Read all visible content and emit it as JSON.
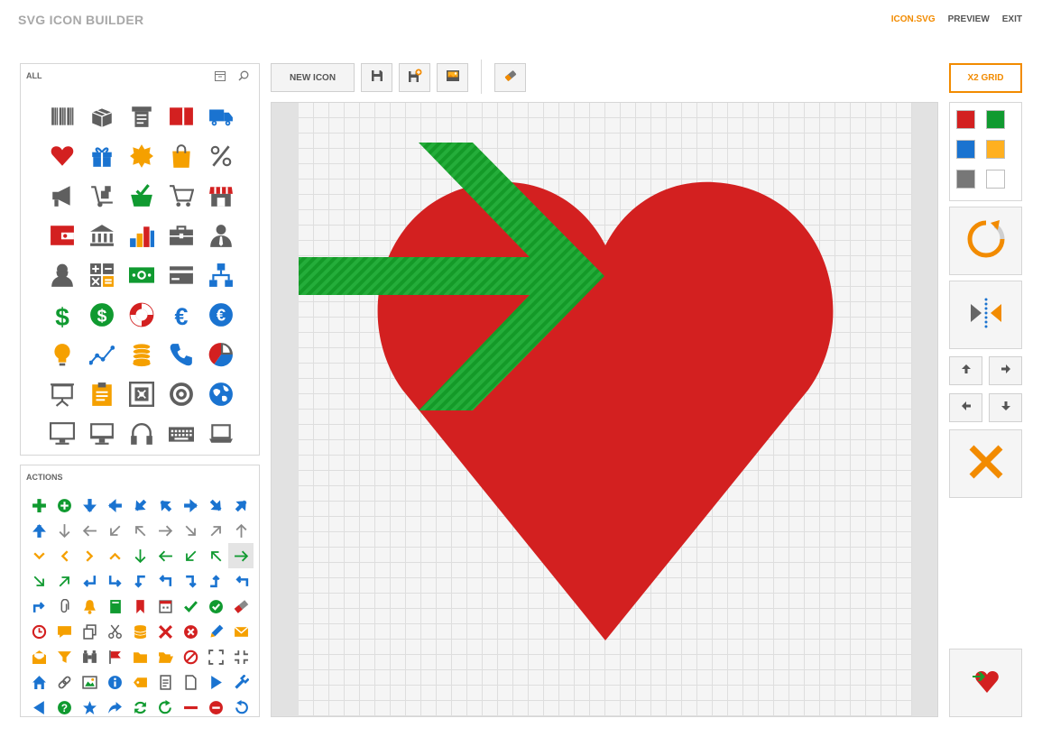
{
  "header": {
    "title": "SVG ICON BUILDER",
    "nav": [
      {
        "label": "ICON.SVG",
        "active": true
      },
      {
        "label": "PREVIEW",
        "active": false
      },
      {
        "label": "EXIT",
        "active": false
      }
    ]
  },
  "library": {
    "title": "ALL",
    "tools": [
      "panel-icon",
      "search-icon"
    ],
    "icons": [
      "barcode-icon",
      "package-box-icon",
      "receipt-printer-icon",
      "credit-card-red-icon",
      "delivery-truck-icon",
      "heart-icon",
      "gift-icon",
      "badge-star-icon",
      "shopping-bag-icon",
      "percent-icon",
      "megaphone-icon",
      "hand-truck-icon",
      "basket-check-icon",
      "shopping-cart-icon",
      "store-icon",
      "wallet-icon",
      "bank-icon",
      "bar-chart-icon",
      "briefcase-icon",
      "businessman-icon",
      "businesswoman-icon",
      "calculator-icon",
      "banknote-icon",
      "card-icon",
      "org-chart-icon",
      "dollar-icon",
      "dollar-circle-icon",
      "lifebuoy-icon",
      "euro-icon",
      "euro-circle-icon",
      "lightbulb-icon",
      "line-graph-icon",
      "coins-stack-icon",
      "phone-icon",
      "pie-chart-icon",
      "presentation-board-icon",
      "clipboard-icon",
      "safe-icon",
      "target-icon",
      "globe-icon",
      "monitor-icon",
      "computer-icon",
      "headphones-icon",
      "keyboard-icon",
      "laptop-icon"
    ]
  },
  "actions": {
    "title": "ACTIONS",
    "selected_index": 26,
    "icons": [
      "plus-icon",
      "plus-circle-icon",
      "arrow-down-icon",
      "arrow-left-icon",
      "arrow-down-left-icon",
      "arrow-up-left-icon",
      "arrow-right-icon",
      "arrow-down-right-icon",
      "arrow-up-right-icon",
      "arrow-up-icon",
      "arrow-down-thin-icon",
      "arrow-left-thin-icon",
      "arrow-down-left-thin-icon",
      "arrow-up-left-thin-icon",
      "arrow-right-thin-icon",
      "arrow-down-right-thin-icon",
      "arrow-up-right-thin-icon",
      "arrow-up-thin-icon",
      "chevron-down-icon",
      "chevron-left-icon",
      "chevron-right-icon",
      "chevron-up-icon",
      "arrow-down-green-icon",
      "arrow-left-green-icon",
      "arrow-down-left-green-icon",
      "arrow-up-left-green-icon",
      "arrow-right-green-icon",
      "arrow-down-right-green-icon",
      "arrow-up-right-green-icon",
      "return-left-icon",
      "turn-right-down-icon",
      "turn-left-down-icon",
      "turn-up-left-icon",
      "turn-down-right-icon",
      "turn-up-right-icon",
      "turn-left-up-icon",
      "turn-right-up-icon",
      "paperclip-icon",
      "bell-icon",
      "book-icon",
      "bookmark-icon",
      "calendar-icon",
      "check-icon",
      "check-circle-icon",
      "eraser-icon",
      "clock-icon",
      "chat-bubble-icon",
      "copy-icon",
      "scissors-icon",
      "database-icon",
      "close-icon",
      "close-circle-icon",
      "pencil-icon",
      "mail-icon",
      "open-mail-icon",
      "filter-icon",
      "binoculars-icon",
      "flag-icon",
      "folder-icon",
      "folder-open-icon",
      "no-entry-icon",
      "expand-icon",
      "collapse-icon",
      "home-icon",
      "link-icon",
      "image-icon",
      "info-icon",
      "tag-icon",
      "document-list-icon",
      "document-icon",
      "play-icon",
      "wrench-icon",
      "play-left-icon",
      "help-icon",
      "star-icon",
      "share-icon",
      "refresh-icon",
      "redo-icon",
      "minus-icon",
      "minus-circle-icon",
      "undo-icon"
    ]
  },
  "toolbar": {
    "new_icon_label": "NEW ICON",
    "buttons": [
      "save-icon",
      "save-as-icon",
      "export-image-icon",
      "eraser-icon"
    ]
  },
  "canvas": {
    "shapes": [
      {
        "name": "heart-shape",
        "color": "#d32020"
      },
      {
        "name": "arrow-shape",
        "color": "#1a9c2e"
      }
    ]
  },
  "sidebar": {
    "grid_label": "X2 GRID",
    "colors": [
      "#d32020",
      "#109a30",
      "#1a73d0",
      "#ffb020",
      "#777777",
      "#ffffff"
    ],
    "controls": [
      "rotate-icon",
      "flip-horizontal-icon",
      "move-up-icon",
      "move-right-icon",
      "move-left-icon",
      "move-down-icon",
      "delete-icon"
    ],
    "preview_icon": "heart-arrow-preview-icon"
  }
}
